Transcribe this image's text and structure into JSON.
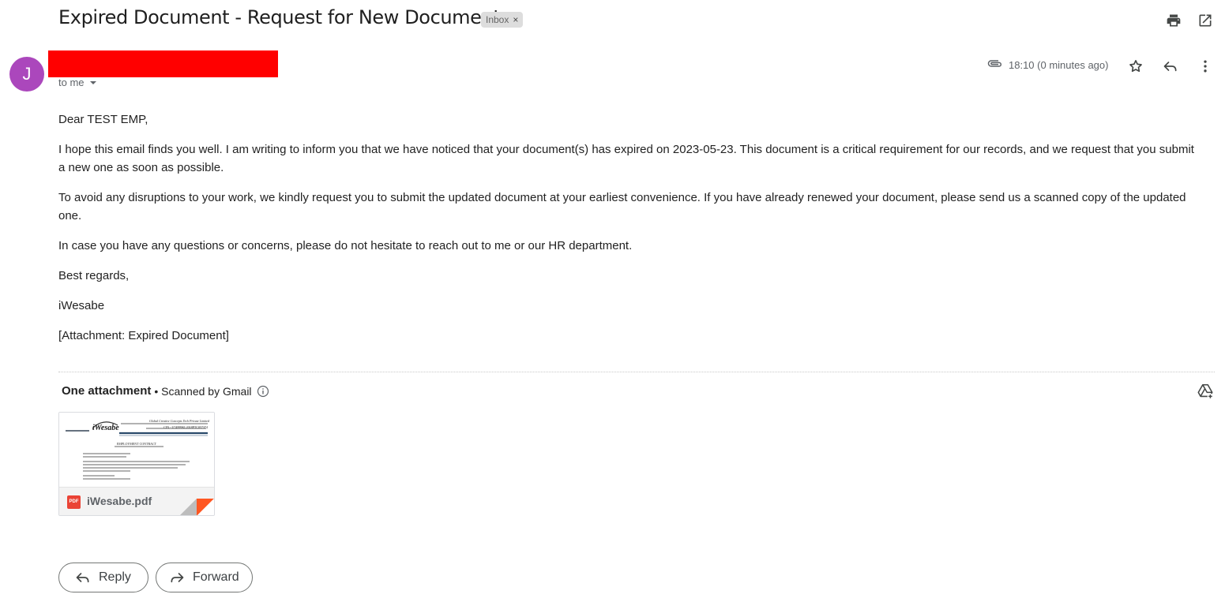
{
  "email": {
    "subject": "Expired Document - Request for New Document",
    "label": "Inbox",
    "label_remove": "×",
    "sender_initial": "J",
    "recipient": "to me",
    "time": "18:10 (0 minutes ago)",
    "body": [
      "Dear TEST EMP,",
      "I hope this email finds you well. I am writing to inform you that we have noticed that your document(s) has expired on 2023-05-23. This document is a critical requirement for our records, and we request that you submit a new one as soon as possible.",
      "To avoid any disruptions to your work, we kindly request you to submit the updated document at your earliest convenience. If you have already renewed your document, please send us a scanned copy of the updated one.",
      "In case you have any questions or concerns, please do not hesitate to reach out to me or our HR department.",
      "Best regards,",
      "iWesabe",
      "[Attachment: Expired Document]"
    ]
  },
  "attachments": {
    "count_label": "One attachment",
    "scan_label": " • Scanned by Gmail",
    "file": {
      "name": "iWesabe.pdf",
      "type_badge": "PDF",
      "preview": {
        "company": "Global Creative Concepts Tech Private Limited",
        "cin": "CIN - U74999KL2018PTC057374",
        "logo": "iWesabe",
        "heading": "EMPLOYMENT CONTRACT"
      }
    }
  },
  "actions": {
    "reply": "Reply",
    "forward": "Forward"
  },
  "icons": [
    "print-icon",
    "open-new-window-icon",
    "attachment-icon",
    "star-icon",
    "reply-icon",
    "more-vert-icon",
    "info-icon",
    "add-to-drive-icon",
    "forward-icon",
    "chevron-down-icon"
  ],
  "colors": {
    "avatar": "#ab47bc",
    "redaction": "#ff0000",
    "pdf": "#ea4335"
  }
}
